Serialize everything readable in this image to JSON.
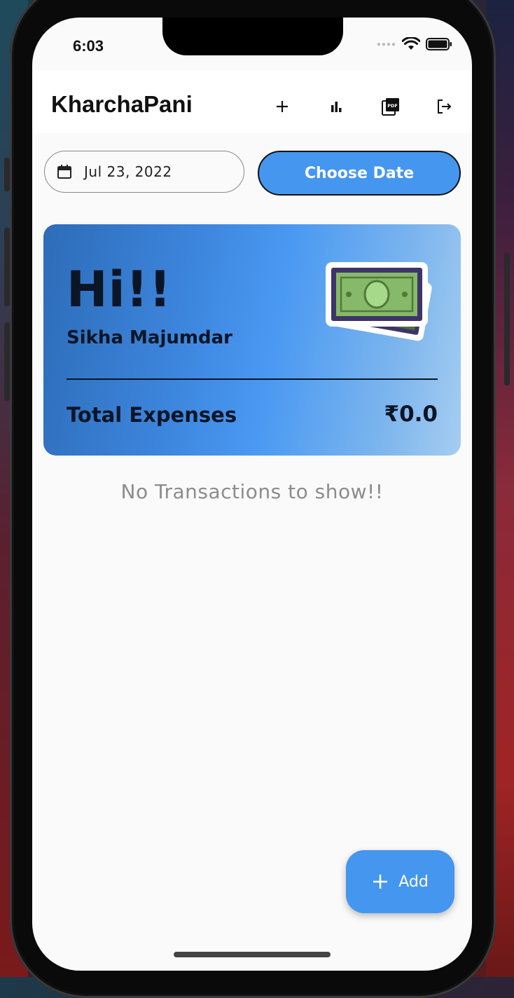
{
  "status_bar": {
    "time": "6:03"
  },
  "app_bar": {
    "title": "KharchaPani",
    "actions": [
      {
        "icon": "plus-icon"
      },
      {
        "icon": "bar-chart-icon"
      },
      {
        "icon": "pdf-icon",
        "text": "PDF"
      },
      {
        "icon": "logout-icon"
      }
    ]
  },
  "date_picker": {
    "selected_date": "Jul 23, 2022",
    "button_label": "Choose Date"
  },
  "summary_card": {
    "greeting": "Hi!!",
    "user_name": "Sikha Majumdar",
    "total_label": "Total Expenses",
    "total_value": "₹0.0",
    "illustration": "money-banknote-icon"
  },
  "transactions": {
    "empty_message": "No Transactions to show!!"
  },
  "fab": {
    "label": "Add",
    "icon": "plus-icon"
  },
  "colors": {
    "accent": "#4596ee",
    "card_gradient_start": "#2d6cb8",
    "card_gradient_end": "#a5cdf0",
    "text_dark": "#0b1525",
    "muted_text": "#8c8c8c"
  }
}
